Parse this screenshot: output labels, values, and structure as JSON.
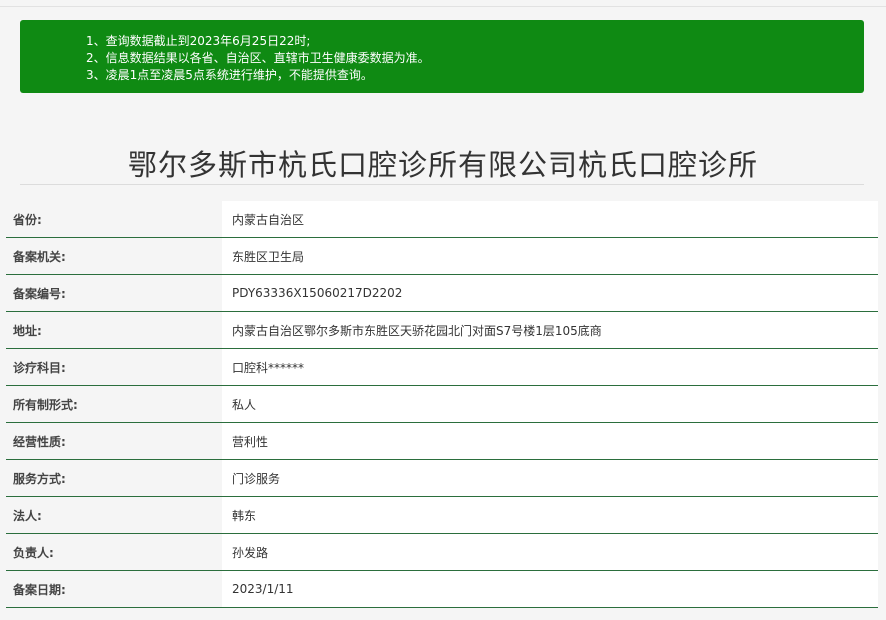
{
  "notice": {
    "items": [
      "1、查询数据截止到2023年6月25日22时;",
      "2、信息数据结果以各省、自治区、直辖市卫生健康委数据为准。",
      "3、凌晨1点至凌晨5点系统进行维护，不能提供查询。"
    ]
  },
  "title": "鄂尔多斯市杭氏口腔诊所有限公司杭氏口腔诊所",
  "rows": [
    {
      "label": "省份:",
      "value": "内蒙古自治区"
    },
    {
      "label": "备案机关:",
      "value": "东胜区卫生局"
    },
    {
      "label": "备案编号:",
      "value": "PDY63336X15060217D2202"
    },
    {
      "label": "地址:",
      "value": "内蒙古自治区鄂尔多斯市东胜区天骄花园北门对面S7号楼1层105底商"
    },
    {
      "label": "诊疗科目:",
      "value": "口腔科******"
    },
    {
      "label": "所有制形式:",
      "value": "私人"
    },
    {
      "label": "经营性质:",
      "value": "营利性"
    },
    {
      "label": "服务方式:",
      "value": "门诊服务"
    },
    {
      "label": "法人:",
      "value": "韩东"
    },
    {
      "label": "负责人:",
      "value": "孙发路"
    },
    {
      "label": "备案日期:",
      "value": "2023/1/11"
    }
  ],
  "colors": {
    "notice_bg": "#0f8a13",
    "row_border": "#2b6e3d"
  }
}
